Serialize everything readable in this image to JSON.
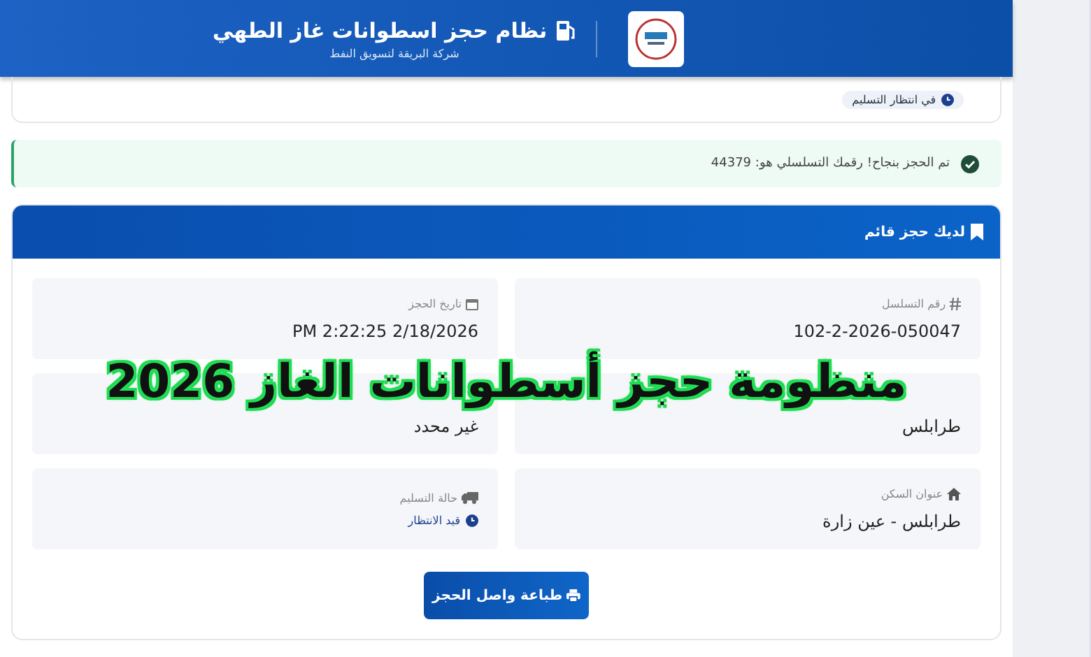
{
  "header": {
    "title": "نظام حجز اسطوانات غاز الطهي",
    "subtitle": "شركة البريقة لتسويق النفط"
  },
  "previous_card": {
    "status_badge": "في انتظار التسليم"
  },
  "alert": {
    "message": "تم الحجز بنجاح! رقمك التسلسلي هو: 44379"
  },
  "booking": {
    "title": "لديك حجز قائم",
    "fields": [
      {
        "kind": "text",
        "label": "رقم التسلسل",
        "value": "102-2-2026-050047"
      },
      {
        "kind": "text",
        "label": "تاريخ الحجز",
        "value": "PM 2:22:25 2/18/2026"
      },
      {
        "kind": "text",
        "value": "طرابلس"
      },
      {
        "kind": "text",
        "value": "غير محدد"
      },
      {
        "kind": "text",
        "label": "عنوان السكن",
        "value": "طرابلس - عين زارة"
      },
      {
        "kind": "badge",
        "label": "حالة التسليم",
        "value": "قيد الانتظار"
      }
    ],
    "print_button": "طباعة واصل الحجز"
  },
  "overlay_title": "منظومة حجز أسطوانات الغاز 2026"
}
